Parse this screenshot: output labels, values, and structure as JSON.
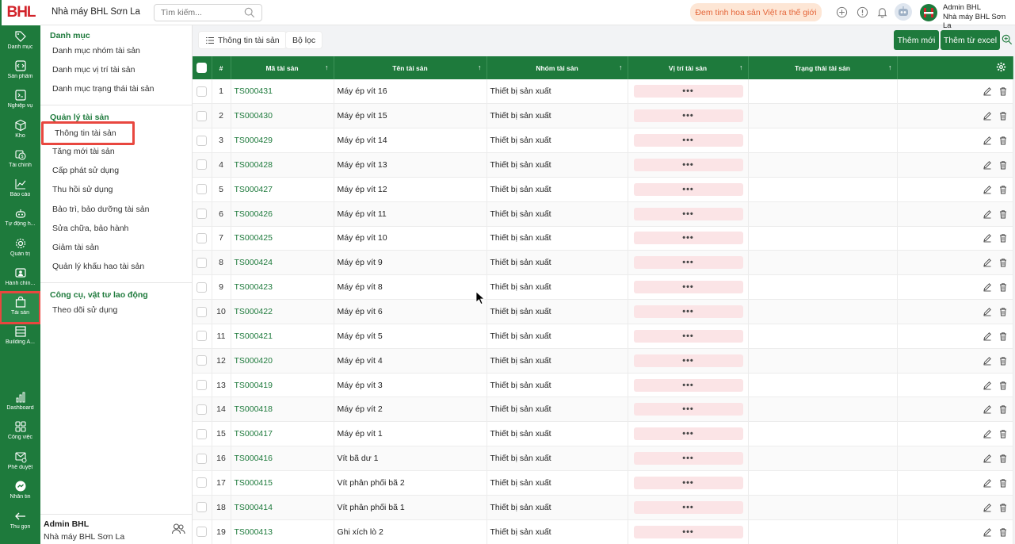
{
  "brand": {
    "logo_text": "BHL"
  },
  "header": {
    "org_name": "Nhà máy BHL Sơn La",
    "search_placeholder": "Tìm kiếm...",
    "slogan": "Đem tinh hoa sản Việt ra thế giới",
    "user_name": "Admin BHL",
    "user_org": "Nhà máy BHL Sơn La"
  },
  "rail": [
    {
      "label": "Danh mục",
      "icon": "tag-icon"
    },
    {
      "label": "Sản phẩm",
      "icon": "code-box-icon"
    },
    {
      "label": "Nghiệp vụ",
      "icon": "terminal-icon"
    },
    {
      "label": "Kho",
      "icon": "box-icon"
    },
    {
      "label": "Tài chính",
      "icon": "finance-icon"
    },
    {
      "label": "Báo cáo",
      "icon": "chart-line-icon"
    },
    {
      "label": "Tự động h...",
      "icon": "robot-icon"
    },
    {
      "label": "Quản trị",
      "icon": "gear-icon"
    },
    {
      "label": "Hành chín...",
      "icon": "id-card-icon"
    },
    {
      "label": "Tài sản",
      "icon": "bag-icon"
    },
    {
      "label": "Building A...",
      "icon": "building-icon"
    },
    {
      "label": "Dashboard",
      "icon": "bar-chart-icon"
    },
    {
      "label": "Công việc",
      "icon": "grid-icon"
    },
    {
      "label": "Phê duyệt",
      "icon": "mail-check-icon"
    },
    {
      "label": "Nhắn tin",
      "icon": "messenger-icon"
    },
    {
      "label": "Thu gọn",
      "icon": "arrow-left-icon"
    }
  ],
  "subnav": {
    "section1_title": "Danh mục",
    "section1_items": [
      "Danh mục nhóm tài sản",
      "Danh mục vị trí tài sản",
      "Danh mục trạng thái tài sản"
    ],
    "section2_title": "Quản lý tài sản",
    "section2_items": [
      "Thông tin tài sản",
      "Tăng mới tài sản",
      "Cấp phát sử dụng",
      "Thu hồi sử dụng",
      "Bảo trì, bảo dưỡng tài sản",
      "Sửa chữa, bảo hành",
      "Giảm tài sản",
      "Quản lý khấu hao tài sản"
    ],
    "section3_title": "Công cụ, vật tư lao động",
    "section3_items": [
      "Theo dõi sử dụng"
    ],
    "footer_name": "Admin BHL",
    "footer_org": "Nhà máy BHL Sơn La"
  },
  "toolbar": {
    "tab_info": "Thông tin tài sản",
    "tab_filter": "Bộ lọc",
    "btn_add": "Thêm mới",
    "btn_import": "Thêm từ excel"
  },
  "table": {
    "columns": [
      "#",
      "Mã tài sản",
      "Tên tài sản",
      "Nhóm tài sản",
      "Vị trí tài sản",
      "Trạng thái tài sản"
    ],
    "location_placeholder": "•••",
    "rows": [
      {
        "n": "1",
        "code": "TS000431",
        "name": "Máy ép vít 16",
        "group": "Thiết bị sản xuất"
      },
      {
        "n": "2",
        "code": "TS000430",
        "name": "Máy ép vít 15",
        "group": "Thiết bị sản xuất"
      },
      {
        "n": "3",
        "code": "TS000429",
        "name": "Máy ép vít 14",
        "group": "Thiết bị sản xuất"
      },
      {
        "n": "4",
        "code": "TS000428",
        "name": "Máy ép vít 13",
        "group": "Thiết bị sản xuất"
      },
      {
        "n": "5",
        "code": "TS000427",
        "name": "Máy ép vít 12",
        "group": "Thiết bị sản xuất"
      },
      {
        "n": "6",
        "code": "TS000426",
        "name": "Máy ép vít 11",
        "group": "Thiết bị sản xuất"
      },
      {
        "n": "7",
        "code": "TS000425",
        "name": "Máy ép vít 10",
        "group": "Thiết bị sản xuất"
      },
      {
        "n": "8",
        "code": "TS000424",
        "name": "Máy ép vít 9",
        "group": "Thiết bị sản xuất"
      },
      {
        "n": "9",
        "code": "TS000423",
        "name": "Máy ép vít 8",
        "group": "Thiết bị sản xuất"
      },
      {
        "n": "10",
        "code": "TS000422",
        "name": "Máy ép vít 6",
        "group": "Thiết bị sản xuất"
      },
      {
        "n": "11",
        "code": "TS000421",
        "name": "Máy ép vít 5",
        "group": "Thiết bị sản xuất"
      },
      {
        "n": "12",
        "code": "TS000420",
        "name": "Máy ép vít 4",
        "group": "Thiết bị sản xuất"
      },
      {
        "n": "13",
        "code": "TS000419",
        "name": "Máy ép vít 3",
        "group": "Thiết bị sản xuất"
      },
      {
        "n": "14",
        "code": "TS000418",
        "name": "Máy ép vít 2",
        "group": "Thiết bị sản xuất"
      },
      {
        "n": "15",
        "code": "TS000417",
        "name": "Máy ép vít 1",
        "group": "Thiết bị sản xuất"
      },
      {
        "n": "16",
        "code": "TS000416",
        "name": "Vít bã dư 1",
        "group": "Thiết bị sản xuất"
      },
      {
        "n": "17",
        "code": "TS000415",
        "name": "Vít phân phối bã 2",
        "group": "Thiết bị sản xuất"
      },
      {
        "n": "18",
        "code": "TS000414",
        "name": "Vít phân phối bã 1",
        "group": "Thiết bị sản xuất"
      },
      {
        "n": "19",
        "code": "TS000413",
        "name": "Ghi xích lò 2",
        "group": "Thiết bị sản xuất"
      }
    ]
  },
  "colors": {
    "brand_green": "#1e7a3c",
    "brand_red": "#d2232a",
    "highlight": "#e8473f",
    "location_pill": "#fbe4e6",
    "slogan_bg": "#fde6d5"
  }
}
